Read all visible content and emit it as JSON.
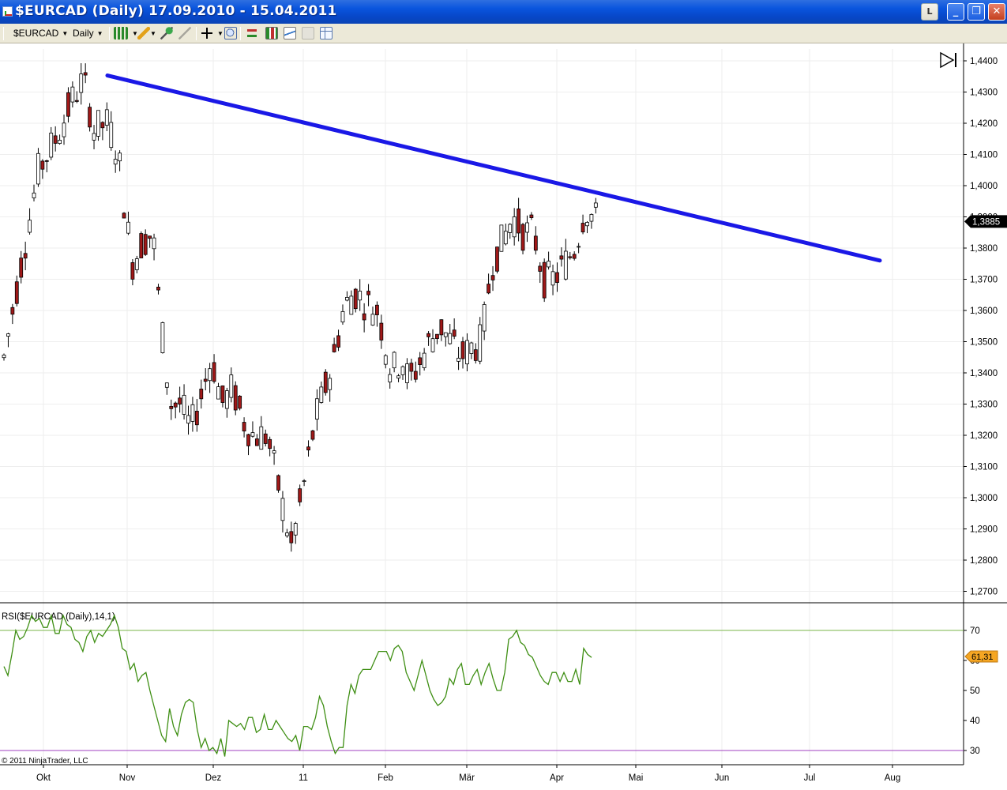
{
  "window": {
    "title": "$EURCAD (Daily)  17.09.2010 - 15.04.2011",
    "l_button": "L"
  },
  "toolbar": {
    "instrument": "$EURCAD",
    "interval": "Daily"
  },
  "price_axis": {
    "ticks": [
      "1,4400",
      "1,4300",
      "1,4200",
      "1,4100",
      "1,4000",
      "1,3900",
      "1,3800",
      "1,3700",
      "1,3600",
      "1,3500",
      "1,3400",
      "1,3300",
      "1,3200",
      "1,3100",
      "1,3000",
      "1,2900",
      "1,2800",
      "1,2700"
    ],
    "last_price_label": "1,3885"
  },
  "rsi_panel": {
    "label": "RSI($EURCAD (Daily),14,1)",
    "ticks": [
      "70",
      "60",
      "50",
      "40",
      "30"
    ],
    "last_value_label": "61,31",
    "upper_line": 70,
    "lower_line": 30
  },
  "time_axis": {
    "labels": [
      "Okt",
      "Nov",
      "Dez",
      "11",
      "Feb",
      "Mär",
      "Apr",
      "Mai",
      "Jun",
      "Jul",
      "Aug"
    ]
  },
  "copyright": "© 2011 NinjaTrader, LLC",
  "colors": {
    "up_candle": "#ffffff",
    "down_candle": "#a01818",
    "trendline": "#1a18e6",
    "rsi_line": "#3f8f14",
    "rsi_upper": "#7ab648",
    "rsi_lower": "#a040c0",
    "last_price_marker": "#000000",
    "rsi_marker": "#f5a623"
  },
  "chart_data": {
    "type": "candlestick",
    "price_range": [
      1.265,
      1.447
    ],
    "rsi_range": [
      25,
      78
    ],
    "trendline": [
      {
        "date": "2010-10-25",
        "price": 1.4353
      },
      {
        "date": "2011-07-27",
        "price": 1.376
      }
    ],
    "rsi": [
      58,
      55,
      62,
      70,
      67,
      68,
      71,
      75,
      73,
      74,
      71,
      71,
      75,
      69,
      69,
      75,
      72,
      71,
      67,
      66,
      63,
      68,
      70,
      66,
      69,
      68,
      70,
      72,
      75,
      71,
      64,
      63,
      57,
      59,
      53,
      55,
      56,
      50,
      45,
      40,
      35,
      33,
      44,
      38,
      35,
      42,
      46,
      47,
      46,
      37,
      31,
      34,
      30,
      31,
      29,
      34,
      28,
      40,
      39,
      38,
      39,
      37,
      41,
      41,
      36,
      37,
      42,
      37,
      37,
      40,
      38,
      36,
      34,
      33,
      35,
      30,
      38,
      38,
      37,
      41,
      48,
      45,
      38,
      33,
      29,
      31,
      31,
      45,
      52,
      49,
      55,
      57,
      57,
      57,
      60,
      63,
      63,
      63,
      60,
      64,
      65,
      63,
      56,
      53,
      50,
      55,
      60,
      55,
      50,
      47,
      45,
      46,
      48,
      54,
      52,
      57,
      59,
      52,
      52,
      55,
      57,
      52,
      56,
      59,
      54,
      50,
      50,
      56,
      67,
      68,
      70,
      66,
      65,
      62,
      61,
      58,
      55,
      53,
      52,
      56,
      56,
      53,
      56,
      53,
      53,
      57,
      52,
      64,
      62,
      61
    ]
  }
}
